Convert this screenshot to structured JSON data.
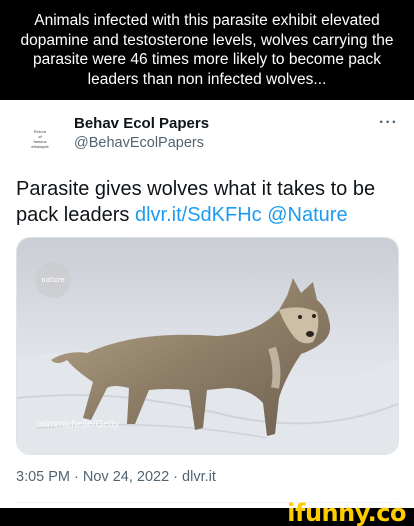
{
  "meme": {
    "caption": "Animals infected with this parasite exhibit elevated dopamine and testosterone levels, wolves carrying the parasite were 46 times more likely to become pack leaders than non infected wolves..."
  },
  "tweet": {
    "account_name": "Behav Ecol Papers",
    "handle": "@BehavEcolPapers",
    "avatar_text": "Picture of famous ethologist",
    "more_icon": "more-horizontal-icon",
    "text_main": "Parasite gives wolves what it takes to be pack leaders ",
    "link_url": "dlvr.it/SdKFHc",
    "link_mention": "@Nature",
    "media": {
      "badge": "nature",
      "credit": "mlmmichelle/Getty"
    },
    "timestamp": "3:05 PM · Nov 24, 2022 · dlvr.it"
  },
  "watermark": "ifunny.co",
  "colors": {
    "link": "#1d9bf0",
    "watermark": "#ffcc00",
    "secondary_text": "#536471"
  }
}
